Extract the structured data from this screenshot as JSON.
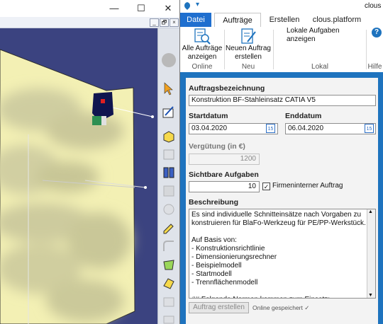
{
  "catia": {
    "window_controls": {
      "minimize": "—",
      "maximize": "☐",
      "close": "✕"
    },
    "doc_controls": {
      "minimize": "_",
      "restore": "🗗",
      "close": "×"
    }
  },
  "clous": {
    "title": "clous",
    "tabs": [
      "Datei",
      "Aufträge",
      "Erstellen",
      "clous.platform"
    ],
    "ribbon": {
      "btn_all_orders": "Alle Aufträge anzeigen",
      "btn_all_orders_l1": "Alle Aufträge",
      "btn_all_orders_l2": "anzeigen",
      "btn_new_order_l1": "Neuen Auftrag",
      "btn_new_order_l2": "erstellen",
      "btn_local_tasks": "Lokale Aufgaben anzeigen",
      "group_online": "Online",
      "group_neu": "Neu",
      "group_lokal": "Lokal",
      "group_hilfe": "Hilfe",
      "help_glyph": "?"
    },
    "form": {
      "label_title": "Auftragsbezeichnung",
      "value_title": "Konstruktion BF-Stahleinsatz CATIA V5",
      "label_start": "Startdatum",
      "value_start": "03.04.2020",
      "label_end": "Enddatum",
      "value_end": "06.04.2020",
      "label_payment": "Vergütung (in €)",
      "value_payment": "1200",
      "label_visible": "Sichtbare Aufgaben",
      "value_visible": "10",
      "checkbox_internal": "Firmeninterner Auftrag",
      "checkbox_internal_checked": true,
      "label_description": "Beschreibung",
      "description_lines": [
        "Es sind individuelle Schnitteinsätze nach Vorgaben zu",
        "konstruieren für BlaFo-Werkzeug für PE/PP-Werkstück.",
        "",
        "Auf Basis von:",
        "- Konstruktionsrichtlinie",
        "- Dimensionierungsrechner",
        "- Beispielmodell",
        "- Startmodell",
        "- Trennflächenmodell",
        "",
        "## Folgende Normen kommen zum Einsatz:"
      ],
      "btn_create": "Auftrag erstellen",
      "status": "Online gespeichert ✓"
    },
    "colors": {
      "accent": "#1e73be",
      "tab_active": "#1f6fcf"
    }
  }
}
